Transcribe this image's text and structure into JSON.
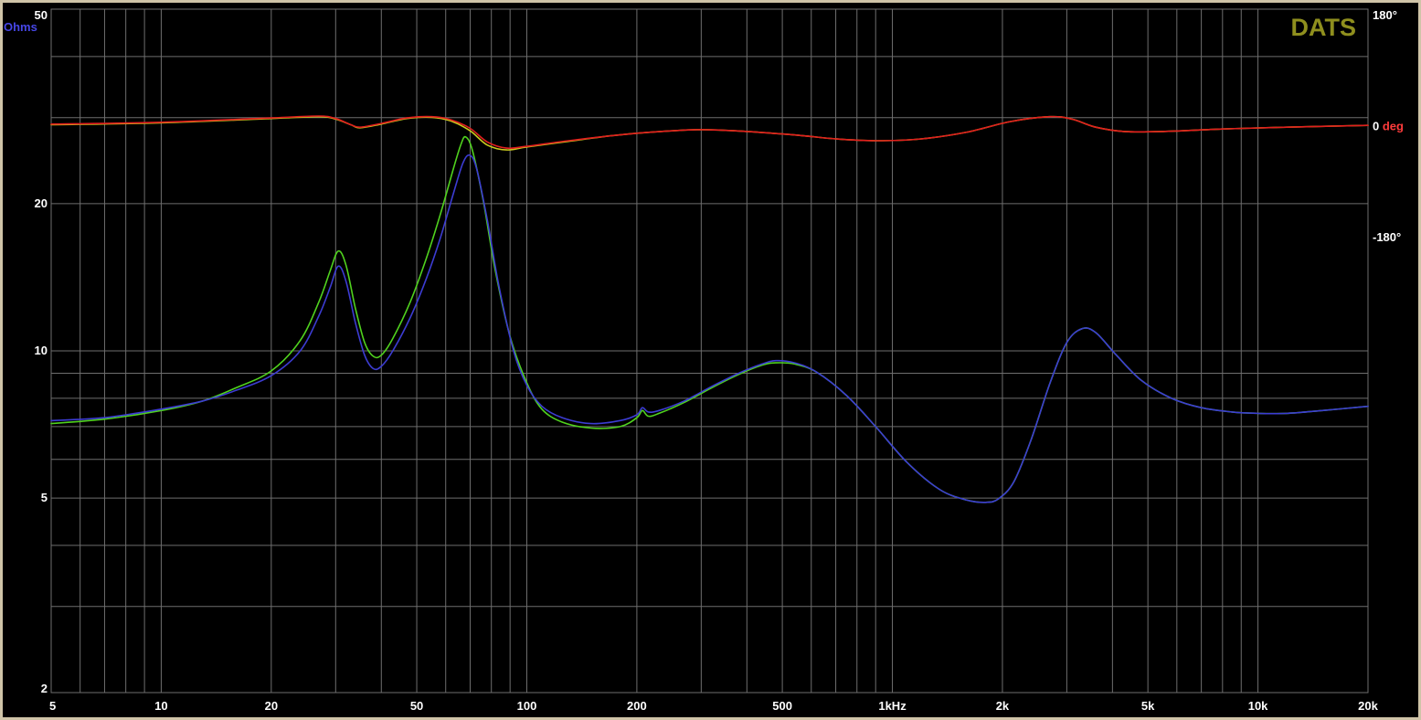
{
  "chart_data": {
    "type": "line",
    "brand": "DATS",
    "x_scale": "log",
    "y_scale": "log",
    "xlim": [
      5,
      20000
    ],
    "ylim": [
      2,
      50
    ],
    "phase_lim": [
      -180,
      180
    ],
    "grid": true,
    "x_ticks": [
      {
        "value": 5,
        "label": "5"
      },
      {
        "value": 10,
        "label": "10"
      },
      {
        "value": 20,
        "label": "20"
      },
      {
        "value": 50,
        "label": "50"
      },
      {
        "value": 100,
        "label": "100"
      },
      {
        "value": 200,
        "label": "200"
      },
      {
        "value": 500,
        "label": "500"
      },
      {
        "value": 1000,
        "label": "1kHz"
      },
      {
        "value": 2000,
        "label": "2k"
      },
      {
        "value": 5000,
        "label": "5k"
      },
      {
        "value": 10000,
        "label": "10k"
      },
      {
        "value": 20000,
        "label": "20k"
      }
    ],
    "y_ticks": [
      {
        "value": 50,
        "label": "50"
      },
      {
        "value": 20,
        "label": "20"
      },
      {
        "value": 10,
        "label": "10"
      },
      {
        "value": 5,
        "label": "5"
      },
      {
        "value": 2,
        "label": "2"
      }
    ],
    "y_unit_label": "Ohms",
    "phase_ticks": [
      {
        "value": 180,
        "label": "180°"
      },
      {
        "value": 0,
        "label": "0",
        "unit": "deg"
      },
      {
        "value": -180,
        "label": "-180°"
      }
    ],
    "colors": {
      "background": "#000000",
      "grid": "#6e6e6e",
      "impedance_a": "#3c3cd2",
      "impedance_b": "#50d21e",
      "phase_a": "#e11e1e",
      "phase_b": "#c8c81e",
      "ohms_label": "#4646e6",
      "deg_label": "#ff3c3c",
      "brand": "#8f8f1e"
    },
    "series": [
      {
        "kind": "impedance",
        "color_key": "impedance_a",
        "points": [
          [
            5,
            7.2
          ],
          [
            7,
            7.3
          ],
          [
            10,
            7.6
          ],
          [
            13,
            7.9
          ],
          [
            16,
            8.3
          ],
          [
            20,
            8.9
          ],
          [
            24,
            10.0
          ],
          [
            27,
            11.8
          ],
          [
            29,
            13.5
          ],
          [
            30.5,
            14.9
          ],
          [
            32,
            13.9
          ],
          [
            34,
            11.4
          ],
          [
            36,
            9.8
          ],
          [
            38,
            9.2
          ],
          [
            40,
            9.3
          ],
          [
            43,
            10.0
          ],
          [
            48,
            11.7
          ],
          [
            53,
            14.0
          ],
          [
            58,
            17.0
          ],
          [
            63,
            21.0
          ],
          [
            67,
            24.3
          ],
          [
            70,
            25.1
          ],
          [
            73,
            23.5
          ],
          [
            78,
            18.5
          ],
          [
            84,
            13.5
          ],
          [
            92,
            10.0
          ],
          [
            100,
            8.5
          ],
          [
            110,
            7.7
          ],
          [
            125,
            7.3
          ],
          [
            150,
            7.1
          ],
          [
            180,
            7.2
          ],
          [
            200,
            7.4
          ],
          [
            207,
            7.65
          ],
          [
            215,
            7.5
          ],
          [
            230,
            7.55
          ],
          [
            270,
            7.9
          ],
          [
            320,
            8.45
          ],
          [
            380,
            9.0
          ],
          [
            440,
            9.4
          ],
          [
            480,
            9.55
          ],
          [
            540,
            9.45
          ],
          [
            620,
            9.05
          ],
          [
            750,
            8.1
          ],
          [
            900,
            7.0
          ],
          [
            1100,
            5.9
          ],
          [
            1350,
            5.2
          ],
          [
            1600,
            4.95
          ],
          [
            1800,
            4.9
          ],
          [
            1950,
            4.98
          ],
          [
            2150,
            5.4
          ],
          [
            2400,
            6.6
          ],
          [
            2700,
            8.6
          ],
          [
            3000,
            10.4
          ],
          [
            3300,
            11.1
          ],
          [
            3600,
            10.9
          ],
          [
            4100,
            9.8
          ],
          [
            4800,
            8.7
          ],
          [
            5800,
            8.0
          ],
          [
            7000,
            7.65
          ],
          [
            8500,
            7.5
          ],
          [
            10000,
            7.45
          ],
          [
            12000,
            7.45
          ],
          [
            15000,
            7.55
          ],
          [
            20000,
            7.7
          ]
        ]
      },
      {
        "kind": "impedance",
        "color_key": "impedance_b",
        "points": [
          [
            5,
            7.1
          ],
          [
            7,
            7.25
          ],
          [
            10,
            7.55
          ],
          [
            13,
            7.9
          ],
          [
            16,
            8.4
          ],
          [
            20,
            9.1
          ],
          [
            24,
            10.5
          ],
          [
            27,
            12.6
          ],
          [
            29,
            14.6
          ],
          [
            30.5,
            16.0
          ],
          [
            32,
            15.0
          ],
          [
            34,
            12.2
          ],
          [
            36,
            10.4
          ],
          [
            38,
            9.75
          ],
          [
            40,
            9.8
          ],
          [
            43,
            10.6
          ],
          [
            48,
            12.6
          ],
          [
            53,
            15.4
          ],
          [
            58,
            19.0
          ],
          [
            63,
            23.6
          ],
          [
            66,
            26.4
          ],
          [
            68,
            27.4
          ],
          [
            71,
            25.7
          ],
          [
            76,
            20.3
          ],
          [
            82,
            14.6
          ],
          [
            90,
            10.7
          ],
          [
            100,
            8.6
          ],
          [
            110,
            7.6
          ],
          [
            125,
            7.15
          ],
          [
            150,
            6.95
          ],
          [
            180,
            7.0
          ],
          [
            200,
            7.3
          ],
          [
            207,
            7.55
          ],
          [
            215,
            7.35
          ],
          [
            230,
            7.45
          ],
          [
            270,
            7.85
          ],
          [
            320,
            8.4
          ],
          [
            380,
            8.95
          ],
          [
            440,
            9.35
          ],
          [
            480,
            9.45
          ],
          [
            540,
            9.4
          ],
          [
            620,
            9.05
          ],
          [
            750,
            8.1
          ],
          [
            900,
            7.0
          ],
          [
            1100,
            5.9
          ],
          [
            1350,
            5.2
          ],
          [
            1600,
            4.95
          ],
          [
            1800,
            4.9
          ],
          [
            1950,
            4.98
          ],
          [
            2150,
            5.4
          ],
          [
            2400,
            6.6
          ],
          [
            2700,
            8.6
          ],
          [
            3000,
            10.4
          ],
          [
            3300,
            11.1
          ],
          [
            3600,
            10.9
          ],
          [
            4100,
            9.8
          ],
          [
            4800,
            8.7
          ],
          [
            5800,
            8.0
          ],
          [
            7000,
            7.65
          ],
          [
            8500,
            7.5
          ],
          [
            10000,
            7.45
          ],
          [
            12000,
            7.45
          ],
          [
            15000,
            7.55
          ],
          [
            20000,
            7.7
          ]
        ]
      },
      {
        "kind": "phase",
        "color_key": "phase_a",
        "points": [
          [
            5,
            4
          ],
          [
            10,
            7
          ],
          [
            20,
            14
          ],
          [
            27,
            17
          ],
          [
            30,
            13
          ],
          [
            33,
            3
          ],
          [
            35,
            -1
          ],
          [
            40,
            5
          ],
          [
            47,
            14
          ],
          [
            55,
            16
          ],
          [
            62,
            11
          ],
          [
            70,
            -3
          ],
          [
            78,
            -25
          ],
          [
            88,
            -35
          ],
          [
            100,
            -32
          ],
          [
            130,
            -23
          ],
          [
            170,
            -15
          ],
          [
            220,
            -9
          ],
          [
            300,
            -5
          ],
          [
            400,
            -8
          ],
          [
            550,
            -14
          ],
          [
            700,
            -20
          ],
          [
            900,
            -23
          ],
          [
            1200,
            -20
          ],
          [
            1600,
            -9
          ],
          [
            2100,
            8
          ],
          [
            2700,
            16
          ],
          [
            3100,
            12
          ],
          [
            3600,
            -1
          ],
          [
            4300,
            -8
          ],
          [
            5500,
            -8
          ],
          [
            8000,
            -4
          ],
          [
            12000,
            -1
          ],
          [
            20000,
            2
          ]
        ]
      },
      {
        "kind": "phase",
        "color_key": "phase_b",
        "points": [
          [
            5,
            3
          ],
          [
            10,
            6
          ],
          [
            20,
            13
          ],
          [
            27,
            16
          ],
          [
            30,
            12
          ],
          [
            33,
            3
          ],
          [
            35,
            -2
          ],
          [
            40,
            4
          ],
          [
            47,
            13
          ],
          [
            55,
            15
          ],
          [
            62,
            9
          ],
          [
            70,
            -7
          ],
          [
            78,
            -30
          ],
          [
            88,
            -38
          ],
          [
            100,
            -33
          ],
          [
            130,
            -24
          ],
          [
            170,
            -15
          ],
          [
            220,
            -9
          ],
          [
            300,
            -5
          ],
          [
            400,
            -8
          ],
          [
            550,
            -14
          ],
          [
            700,
            -20
          ],
          [
            900,
            -23
          ],
          [
            1200,
            -20
          ],
          [
            1600,
            -9
          ],
          [
            2100,
            8
          ],
          [
            2700,
            16
          ],
          [
            3100,
            12
          ],
          [
            3600,
            -1
          ],
          [
            4300,
            -8
          ],
          [
            5500,
            -8
          ],
          [
            8000,
            -4
          ],
          [
            12000,
            -1
          ],
          [
            20000,
            2
          ]
        ]
      }
    ]
  }
}
